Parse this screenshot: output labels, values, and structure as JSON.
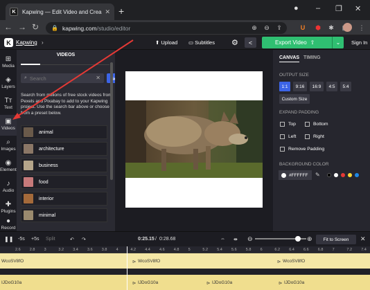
{
  "browser": {
    "tab_title": "Kapwing — Edit Video and Crea",
    "tab_favicon": "K",
    "url_host": "kapwing.com",
    "url_path": "/studio/editor"
  },
  "appbar": {
    "project_name": "Kapwing",
    "slash": "›",
    "upload_label": "Upload",
    "subtitles_label": "Subtitles",
    "export_label": "Export Video",
    "signin_label": "Sign In"
  },
  "rail": {
    "items": [
      {
        "label": "Media",
        "icon": "⊞"
      },
      {
        "label": "Layers",
        "icon": "◈"
      },
      {
        "label": "Text",
        "icon": "Tт"
      },
      {
        "label": "Videos",
        "icon": "▣"
      },
      {
        "label": "Images",
        "icon": "⌕"
      },
      {
        "label": "Elements",
        "icon": "◉"
      },
      {
        "label": "Audio",
        "icon": "♪"
      },
      {
        "label": "Plugins",
        "icon": "✚"
      },
      {
        "label": "Record",
        "icon": "●"
      }
    ]
  },
  "panel": {
    "title": "VIDEOS",
    "search_placeholder": "Search",
    "go_label": "Go",
    "description": "Search from millions of free stock videos from Pexels and Pixabay to add to your Kapwing project. Use the search bar above or choose from a preset below.",
    "categories": [
      {
        "label": "animal",
        "color": "#6a5a4a"
      },
      {
        "label": "architecture",
        "color": "#8b7766"
      },
      {
        "label": "business",
        "color": "#b5a58a"
      },
      {
        "label": "food",
        "color": "#c77a7a"
      },
      {
        "label": "interior",
        "color": "#a46a3a"
      },
      {
        "label": "minimal",
        "color": "#9a8a6e"
      }
    ]
  },
  "right_panel": {
    "tab_canvas": "CANVAS",
    "tab_timing": "TIMING",
    "output_size_label": "OUTPUT SIZE",
    "sizes": [
      "1:1",
      "9:16",
      "16:9",
      "4:5",
      "5:4"
    ],
    "custom_size": "Custom Size",
    "expand_padding_label": "EXPAND PADDING",
    "padding": {
      "top": "Top",
      "bottom": "Bottom",
      "left": "Left",
      "right": "Right",
      "remove": "Remove Padding"
    },
    "bg_color_label": "BACKGROUND COLOR",
    "bg_color_value": "#FFFFFF",
    "swatches": [
      "#000000",
      "#ffffff",
      "#e53935",
      "#fdd835",
      "#1e88e5"
    ]
  },
  "timeline": {
    "minus5": "-5s",
    "plus5": "+5s",
    "split": "Split",
    "current_time": "0:25.15",
    "total_time": "0:28.68",
    "fit_label": "Fit to Screen",
    "ruler": [
      "2.6",
      "2.8",
      "3",
      "3.2",
      "3.4",
      "3.6",
      "3.8",
      "4",
      "4.2",
      "4.4",
      "4.6",
      "4.8",
      "5",
      "5.2",
      "5.4",
      "5.6",
      "5.8",
      "6",
      "6.2",
      "6.4",
      "6.6",
      "6.8",
      "7",
      "7.2",
      "7.4"
    ],
    "track1_clips": [
      "WcoSV8fO",
      "WcoSV8fO",
      "WcoSV8fO"
    ],
    "track2_clips": [
      "IJDoG10a",
      "IJDoG10a",
      "IJDoG10a",
      "IJDoG10a"
    ]
  }
}
